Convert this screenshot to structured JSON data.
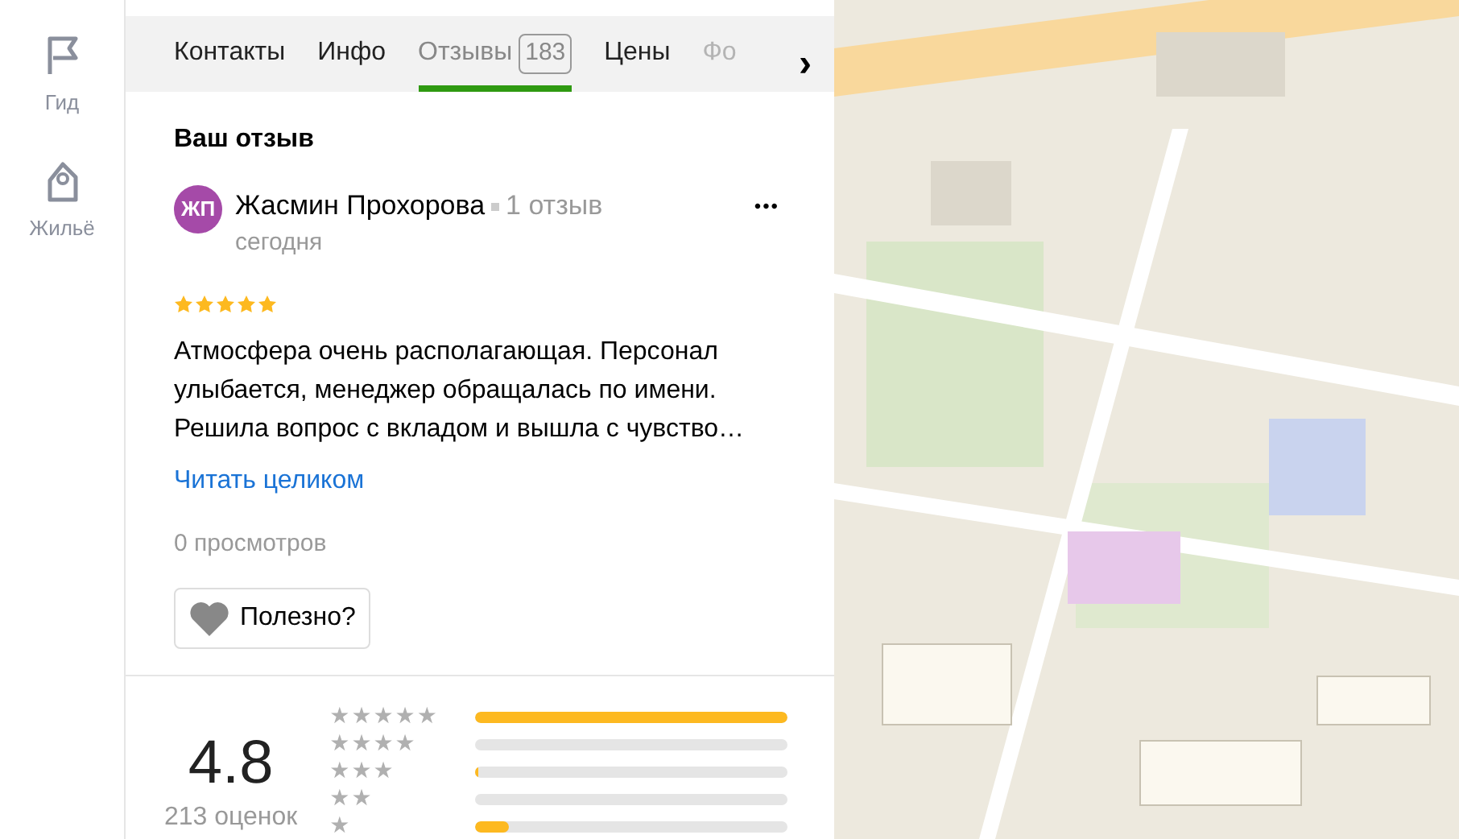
{
  "sidebar": {
    "items": [
      {
        "label": "Гид"
      },
      {
        "label": "Жильё"
      }
    ]
  },
  "tabs": [
    {
      "label": "Контакты",
      "selected": false,
      "faded": false
    },
    {
      "label": "Инфо",
      "selected": false,
      "faded": false
    },
    {
      "label": "Отзывы",
      "count": "183",
      "selected": true,
      "faded": false
    },
    {
      "label": "Цены",
      "selected": false,
      "faded": false
    },
    {
      "label": "Фо",
      "selected": false,
      "faded": true
    }
  ],
  "tabs_next": "›",
  "your_review": {
    "heading": "Ваш отзыв",
    "avatar_initials": "ЖП",
    "author": "Жасмин Прохорова",
    "author_reviews": "1 отзыв",
    "date": "сегодня",
    "stars": 5,
    "text": "Атмосфера очень располагающая. Персонал улыбается, менеджер обращалась по имени. Решила вопрос с вкладом и вышла с чувство…",
    "read_more": "Читать целиком",
    "views": "0 просмотров",
    "useful_button": "Полезно?",
    "menu": "•••"
  },
  "rating": {
    "value": "4.8",
    "count": "213 оценок",
    "distribution": [
      {
        "label": "★★★★★",
        "level": 1.0
      },
      {
        "label": "★★★★",
        "level": 0
      },
      {
        "label": "★★★",
        "level": 0.01
      },
      {
        "label": "★★",
        "level": 0
      },
      {
        "label": "★",
        "level": 0.11
      }
    ]
  }
}
